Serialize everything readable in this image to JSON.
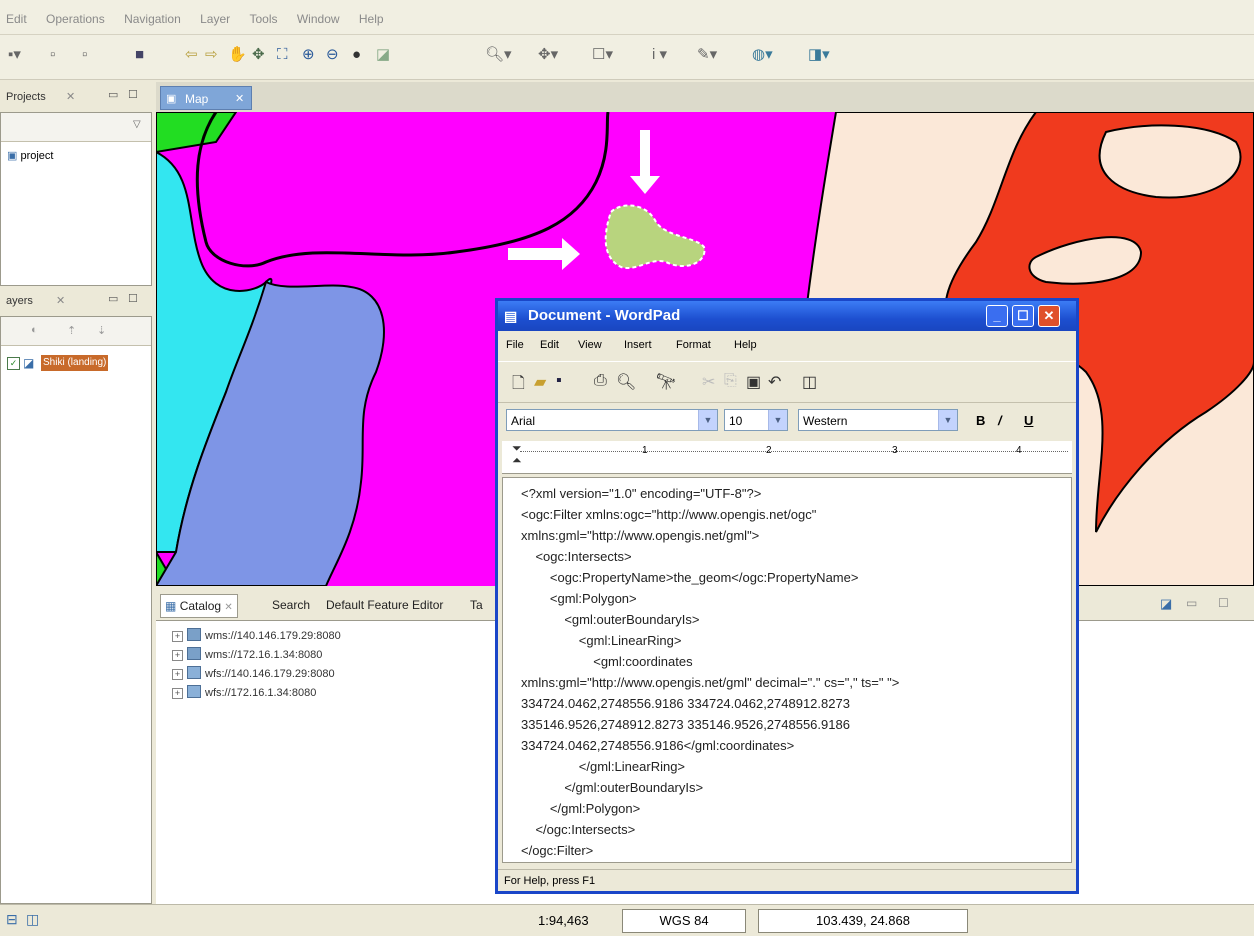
{
  "menubar": [
    "Edit",
    "Operations",
    "Navigation",
    "Layer",
    "Tools",
    "Window",
    "Help"
  ],
  "projects_panel": {
    "tab_label": "Projects",
    "item": "project"
  },
  "layers_panel": {
    "tab_label": "ayers",
    "layer": "Shiki (landing)"
  },
  "map": {
    "tab_label": "Map"
  },
  "catalog": {
    "tabs": [
      "Catalog",
      "Search",
      "Default Feature Editor",
      "Ta"
    ],
    "items": [
      "wms://140.146.179.29:8080",
      "wms://172.16.1.34:8080",
      "wfs://140.146.179.29:8080",
      "wfs://172.16.1.34:8080"
    ]
  },
  "statusbar": {
    "scale": "1:94,463",
    "crs": "WGS 84",
    "coords": "103.439, 24.868"
  },
  "wordpad": {
    "title": "Document - WordPad",
    "menu": [
      "File",
      "Edit",
      "View",
      "Insert",
      "Format",
      "Help"
    ],
    "font": "Arial",
    "size": "10",
    "script": "Western",
    "format_buttons": [
      "B",
      "/",
      "U"
    ],
    "ruler": [
      "1",
      "2",
      "3",
      "4"
    ],
    "lines": [
      "<?xml version=\"1.0\" encoding=\"UTF-8\"?>",
      "<ogc:Filter xmlns:ogc=\"http://www.opengis.net/ogc\"",
      "xmlns:gml=\"http://www.opengis.net/gml\">",
      "    <ogc:Intersects>",
      "        <ogc:PropertyName>the_geom</ogc:PropertyName>",
      "        <gml:Polygon>",
      "            <gml:outerBoundaryIs>",
      "                <gml:LinearRing>",
      "                    <gml:coordinates",
      "xmlns:gml=\"http://www.opengis.net/gml\" decimal=\".\" cs=\",\" ts=\" \">",
      "334724.0462,2748556.9186 334724.0462,2748912.8273",
      "335146.9526,2748912.8273 335146.9526,2748556.9186",
      "334724.0462,2748556.9186</gml:coordinates>",
      "                </gml:LinearRing>",
      "            </gml:outerBoundaryIs>",
      "        </gml:Polygon>",
      "    </ogc:Intersects>",
      "</ogc:Filter>"
    ],
    "status": "For Help, press F1"
  },
  "colors": {
    "magenta": "#ff00ff",
    "cyan": "#33e6f0",
    "periwinkle": "#7e95e6",
    "red": "#f03a1e",
    "cream": "#fbe8d8",
    "green": "#22dd22",
    "selection": "#b8d47e"
  }
}
